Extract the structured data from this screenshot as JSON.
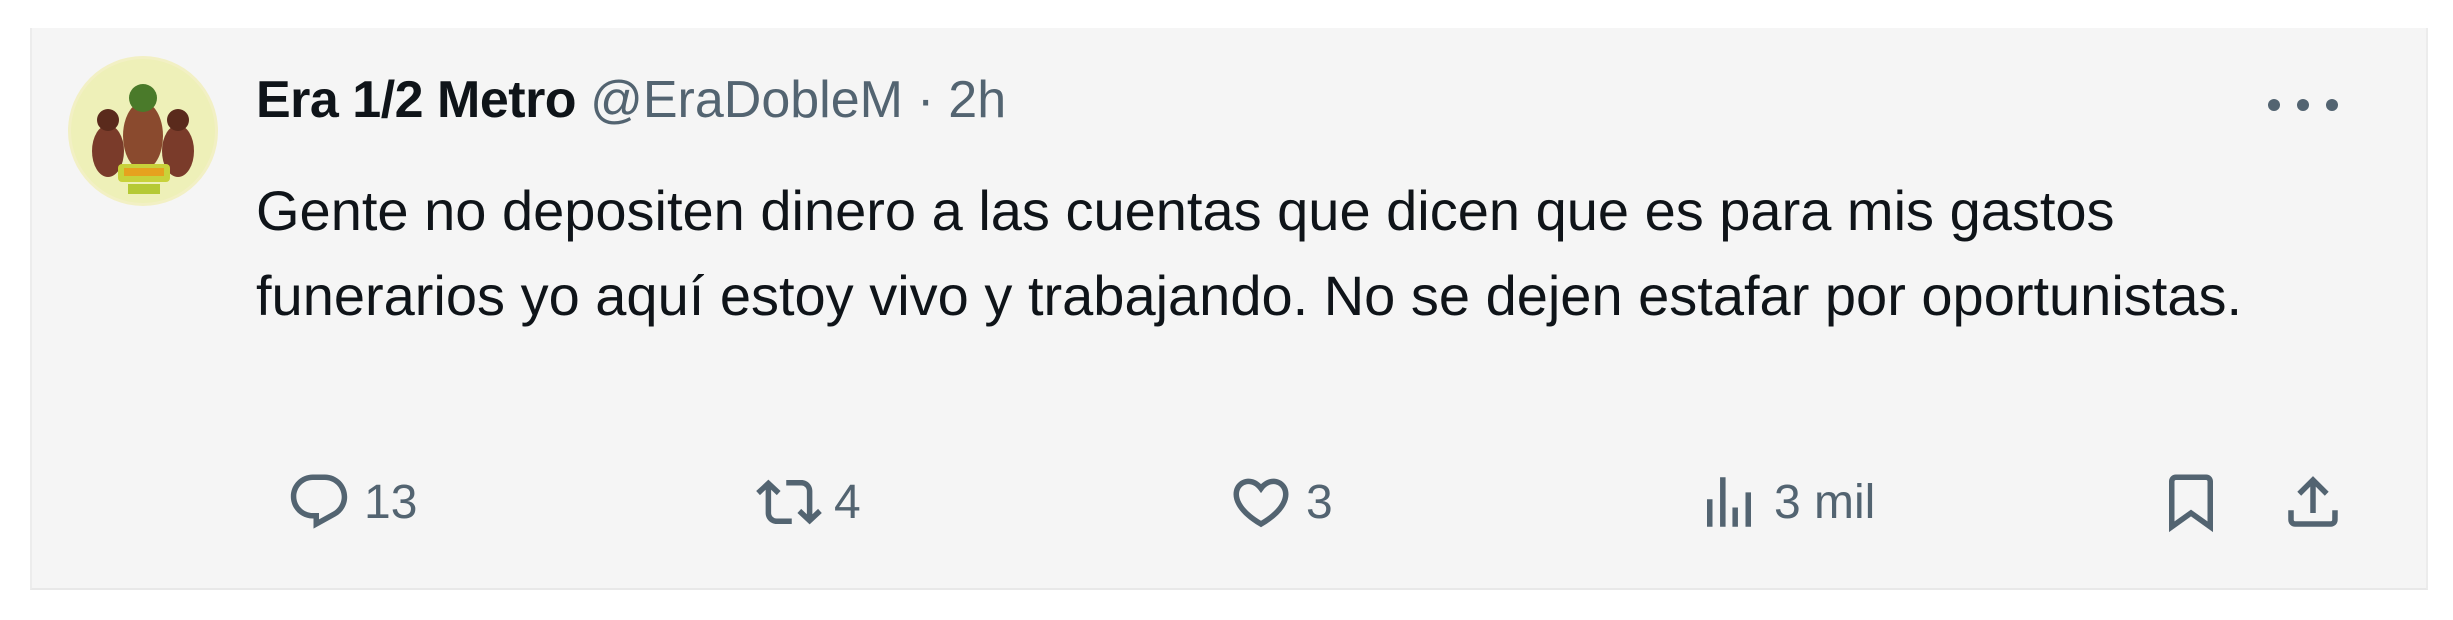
{
  "tweet": {
    "display_name": "Era 1/2 Metro",
    "handle": "@EraDobleM",
    "separator": "·",
    "time": "2h",
    "text": "Gente no depositen dinero a las cuentas que dicen que es para mis gastos funerarios yo aquí estoy vivo y trabajando. No se dejen estafar por oportunistas.",
    "avatar_icon": "avatar-image",
    "more_icon": "more-options-icon"
  },
  "actions": {
    "reply": {
      "icon": "reply-icon",
      "count": "13"
    },
    "retweet": {
      "icon": "retweet-icon",
      "count": "4"
    },
    "like": {
      "icon": "heart-icon",
      "count": "3"
    },
    "views": {
      "icon": "views-chart-icon",
      "count": "3 mil"
    },
    "bookmark": {
      "icon": "bookmark-icon"
    },
    "share": {
      "icon": "share-icon"
    }
  },
  "colors": {
    "card_background": "#f5f5f5",
    "text_primary": "#0f1419",
    "text_secondary": "#536471"
  }
}
